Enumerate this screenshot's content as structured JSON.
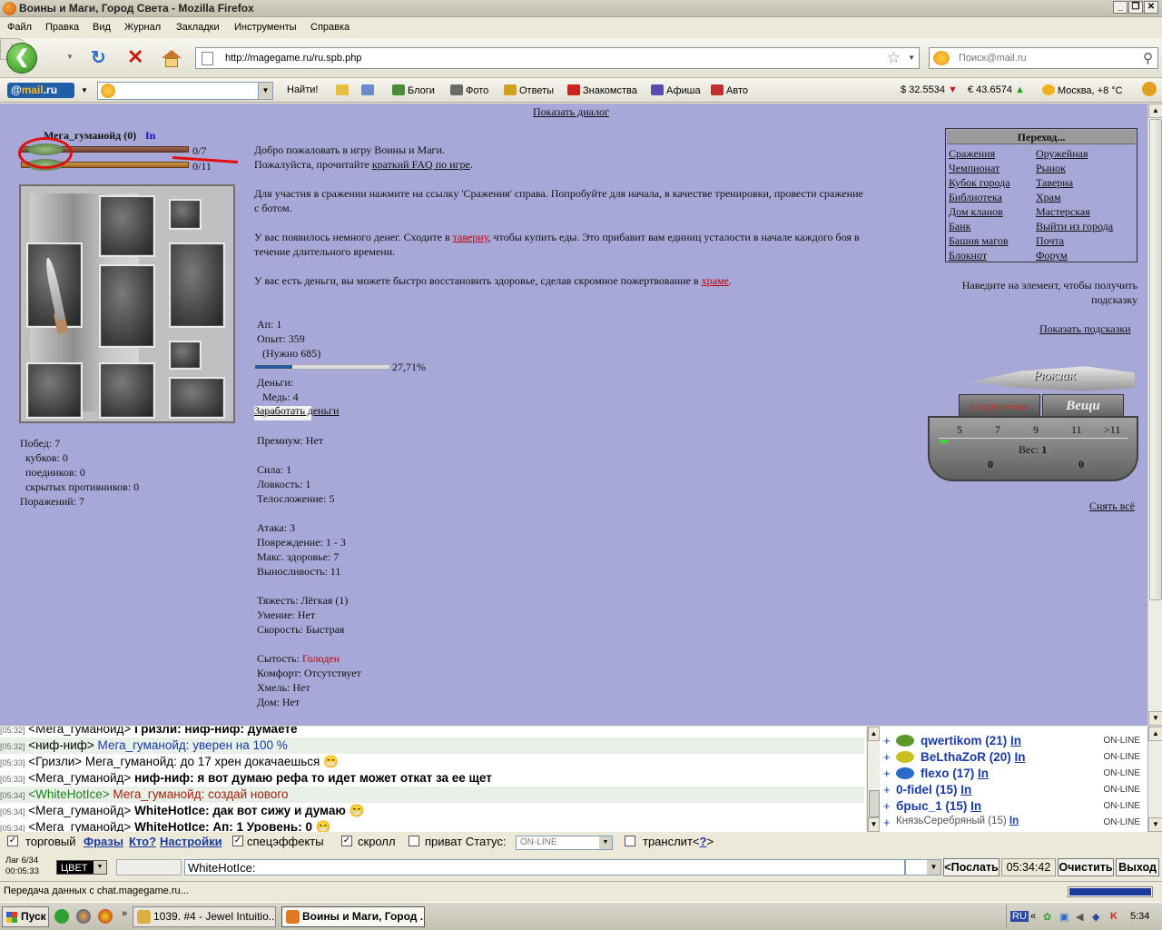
{
  "window": {
    "title": "Воины и Маги, Город Света - Mozilla Firefox"
  },
  "menu": [
    "Файл",
    "Правка",
    "Вид",
    "Журнал",
    "Закладки",
    "Инструменты",
    "Справка"
  ],
  "nav": {
    "url": "http://magegame.ru/ru.spb.php",
    "search_placeholder": "Поиск@mail.ru"
  },
  "mailbar": {
    "logo": "mail.ru",
    "find": "Найти!",
    "items": [
      "Блоги",
      "Фото",
      "Ответы",
      "Знакомства",
      "Афиша",
      "Авто"
    ],
    "usd": "$ 32.5534",
    "eur": "€ 43.6574",
    "weather": "Москва, +8 °C"
  },
  "game": {
    "show_dialog": "Показать диалог",
    "char_name": "Мега_гуманойд (0)",
    "char_link": "In",
    "hp": "0/7",
    "mp": "0/11",
    "stats_left": {
      "wins": "Побед: 7",
      "cups": "кубков: 0",
      "duels": "поединков: 0",
      "hidden": "скрытых противников: 0",
      "losses": "Поражений: 7"
    },
    "welcome": {
      "line1": "Добро пожаловать в игру Воины и Маги.",
      "line2a": "Пожалуйста, прочитайте ",
      "line2link": "краткий FAQ по игре",
      "line2b": ".",
      "p2a": "Для участия в сражении нажмите на ссылку 'Сражения' справа. Попробуйте для начала, в качестве тренировки, провести сражение",
      "p2b": "с ботом.",
      "p3a": "У вас появилось немного денег. Сходите в ",
      "p3link": "таверну",
      "p3b": ", чтобы купить еды. Это прибавит вам единиц усталости в начале каждого боя в",
      "p3c": "течение длительного времени.",
      "p4a": "У вас есть деньги, вы можете быстро восстановить здоровье, сделав скромное пожертвование в ",
      "p4link": "храме",
      "p4b": "."
    },
    "level": "Уровень: 0",
    "ap": "Ап: 1",
    "exp": "Опыт: 359",
    "need": "(Нужно 685)",
    "exp_percent": "27,71%",
    "exp_fraction": 0.2771,
    "money": "Деньги:",
    "copper": "Медь: 4",
    "earn": "Заработать деньги",
    "premium": "Премиум: Нет",
    "strength": "Сила: 1",
    "agility": "Ловкость: 1",
    "body": "Телосложение: 5",
    "attack": "Атака: 3",
    "damage": "Повреждение: 1 - 3",
    "maxhp": "Макс. здоровье: 7",
    "stamina": "Выносливость: 11",
    "weight": "Тяжесть: Лёгкая (1)",
    "skill": "Умение: Нет",
    "speed": "Скорость: Быстрая",
    "satiety_label": "Сытость: ",
    "satiety_value": "Голоден",
    "comfort": "Комфорт: Отсутствует",
    "hops": "Хмель: Нет",
    "home": "Дом: Нет",
    "goto_title": "Переход...",
    "goto_left": [
      "Сражения",
      "Чемпионат",
      "Кубок города",
      "Библиотека",
      "Дом кланов",
      "Банк",
      "Башня магов",
      "Блокнот"
    ],
    "goto_right": [
      "Оружейная",
      "Рынок",
      "Таверна",
      "Храм",
      "Мастерская",
      "Выйти из города",
      "Почта",
      "Форум"
    ],
    "hint1": "Наведите на элемент, чтобы получить",
    "hint2": "подсказку",
    "show_hints": "Показать подсказки",
    "backpack": {
      "title": "Рюкзак",
      "tab_equip": "Снаряжение",
      "tab_items": "Вещи",
      "scale": [
        "5",
        "7",
        "9",
        "11",
        ">11"
      ],
      "weight_label": "Вес:",
      "weight_value": "1",
      "left_count": "0",
      "right_count": "0"
    },
    "remove_all": "Снять всё"
  },
  "chat": {
    "lines": [
      {
        "ts": "[05:32]",
        "nick": "<Мега_гуманойд>",
        "msg": "Гризли: ниф-ниф: думаете",
        "bold": true,
        "bg": "#ffffff",
        "color": "#000000"
      },
      {
        "ts": "[05:32]",
        "nick": "<ниф-ниф>",
        "msg": "Мега_гуманойд: уверен на 100 %",
        "bold": false,
        "bg": "#e8f0e8",
        "color": "#1a3aa0"
      },
      {
        "ts": "[05:33]",
        "nick": "<Гризли>",
        "msg": "Мега_гуманойд: до 17 хрен докачаешься 😁",
        "bold": false,
        "bg": "#ffffff",
        "color": "#000000"
      },
      {
        "ts": "[05:33]",
        "nick": "<Мега_гуманойд>",
        "msg": "ниф-ниф: я вот думаю рефа то идет может откат за ее щет",
        "bold": true,
        "bg": "#ffffff",
        "color": "#000000"
      },
      {
        "ts": "[05:34]",
        "nick": "<WhiteHotIce>",
        "msg": "Мега_гуманойд: создай нового",
        "bold": false,
        "bg": "#e8f0e8",
        "color": "#a02010",
        "nickcolor": "#208020"
      },
      {
        "ts": "[05:34]",
        "nick": "<Мега_гуманойд>",
        "msg": "WhiteHotIce: дак вот сижу и думаю 😁",
        "bold": true,
        "bg": "#ffffff",
        "color": "#000000"
      },
      {
        "ts": "[05:34]",
        "nick": "<Мега_гуманойд>",
        "msg": "WhiteHotIce: Ап: 1 Уровень: 0 😁",
        "bold": true,
        "bg": "#ffffff",
        "color": "#000000"
      }
    ],
    "users": [
      {
        "name": "qwertikom (21)",
        "status": "ON-LINE",
        "avatar": "#5a9a2a"
      },
      {
        "name": "BeLthaZoR (20)",
        "status": "ON-LINE",
        "avatar": "#c8c020"
      },
      {
        "name": "flexo (17)",
        "status": "ON-LINE",
        "avatar": "#2a6ac8"
      },
      {
        "name": "0-fidel (15)",
        "status": "ON-LINE",
        "avatar": ""
      },
      {
        "name": "брыс_1 (15)",
        "status": "ON-LINE",
        "avatar": ""
      },
      {
        "name": "КнязьСеребряный (15)",
        "status": "ON-LINE",
        "avatar": ""
      }
    ],
    "user_link": "In",
    "controls": {
      "trade": "торговый",
      "phrases": "Фразы",
      "who": "Кто?",
      "settings": "Настройки",
      "effects": "спецэффекты",
      "scroll": "скролл",
      "private": "приват Статус:",
      "status_value": "ON-LINE",
      "translit": "транслит<",
      "q": "?",
      "gt": ">"
    },
    "lag_line1": "Лаг 6/34",
    "lag_line2": "00:05:33",
    "color_label": "ЦВЕТ",
    "input_value": "WhiteHotIce:",
    "send": "<Послать",
    "clock": "05:34:42",
    "clear": "Очистить",
    "exit": "Выход"
  },
  "statusbar": {
    "text": "Передача данных с chat.magegame.ru..."
  },
  "taskbar": {
    "start": "Пуск",
    "tasks": [
      "1039. #4 - Jewel Intuitio...",
      "Воины и Маги, Город ..."
    ],
    "lang": "RU",
    "time": "5:34"
  }
}
